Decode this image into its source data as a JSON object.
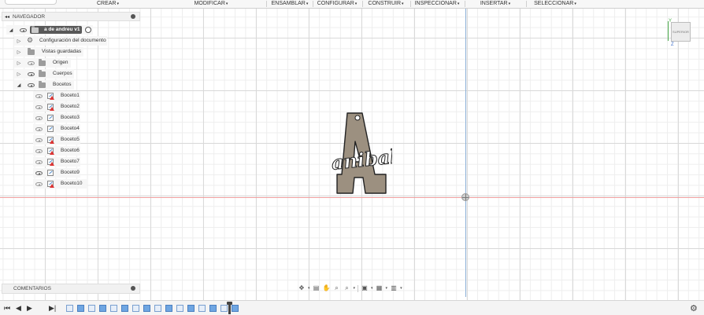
{
  "toolbar": {
    "menus": [
      {
        "label": "CREAR",
        "x_key": "crear"
      },
      {
        "label": "MODIFICAR",
        "x_key": "modificar"
      },
      {
        "label": "ENSAMBLAR",
        "x_key": "ensamblar"
      },
      {
        "label": "CONFIGURAR",
        "x_key": "configurar"
      },
      {
        "label": "CONSTRUIR",
        "x_key": "construir"
      },
      {
        "label": "INSPECCIONAR",
        "x_key": "inspeccionar"
      },
      {
        "label": "INSERTAR",
        "x_key": "insertar"
      },
      {
        "label": "SELECCIONAR",
        "x_key": "seleccionar"
      }
    ],
    "caret": "▾"
  },
  "navigator": {
    "title": "NAVEGADOR",
    "collapse_glyph": "◂◂",
    "root": {
      "label": "a de andreu v1"
    },
    "items": [
      {
        "label": "Configuración del documento",
        "icon": "gear-icon"
      },
      {
        "label": "Vistas guardadas",
        "icon": "folder-icon"
      },
      {
        "label": "Origen",
        "icon": "folder-icon"
      },
      {
        "label": "Cuerpos",
        "icon": "folder-icon"
      },
      {
        "label": "Bocetos",
        "icon": "folder-icon"
      }
    ],
    "sketches": [
      {
        "label": "Boceto1",
        "visible": false
      },
      {
        "label": "Boceto2",
        "visible": false
      },
      {
        "label": "Boceto3",
        "visible": false
      },
      {
        "label": "Boceto4",
        "visible": false
      },
      {
        "label": "Boceto5",
        "visible": false
      },
      {
        "label": "Boceto6",
        "visible": false
      },
      {
        "label": "Boceto7",
        "visible": false
      },
      {
        "label": "Boceto9",
        "visible": true
      },
      {
        "label": "Boceto10",
        "visible": false
      }
    ]
  },
  "comments": {
    "title": "COMENTARIOS"
  },
  "canvas": {
    "logo_letter": "A",
    "logo_text": "anibal",
    "logo_fill": "#9c9080",
    "grid_color": "#d9d9d9",
    "x_axis_color": "#f0a0a0",
    "y_axis_color": "#8ab0d8"
  },
  "viewcube": {
    "face_label": "SUPERIOR",
    "y_label": "Y",
    "z_label": "Z"
  },
  "navbar": {
    "icons": [
      "orbit-icon",
      "look-at-icon",
      "pan-icon",
      "zoom-icon",
      "fit-icon",
      "display-mode-icon",
      "grid-icon",
      "viewports-icon"
    ]
  },
  "timeline": {
    "controls": [
      "⏮",
      "◀",
      "▶",
      "▶|"
    ],
    "feature_count": 16
  }
}
